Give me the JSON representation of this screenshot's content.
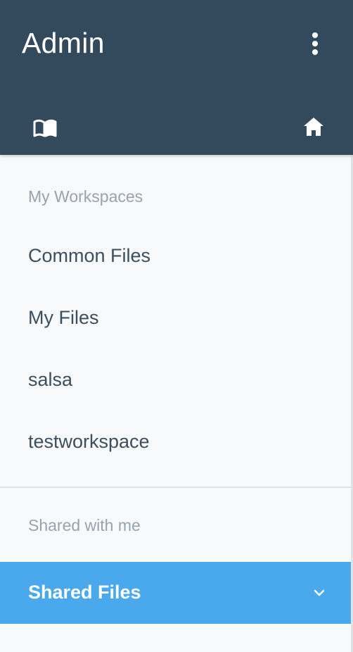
{
  "header": {
    "title": "Admin",
    "menu_icon": "kebab-menu-icon",
    "left_icon": "book-icon",
    "right_icon": "home-icon",
    "background_color": "#33495c"
  },
  "sidebar": {
    "sections": [
      {
        "label": "My Workspaces",
        "items": [
          {
            "label": "Common Files"
          },
          {
            "label": "My Files"
          },
          {
            "label": "salsa"
          },
          {
            "label": "testworkspace"
          }
        ]
      },
      {
        "label": "Shared with me",
        "items": [
          {
            "label": "Shared Files",
            "active": true,
            "icon": "chevron-down-icon"
          }
        ]
      }
    ],
    "active_color": "#4aa8ec"
  }
}
